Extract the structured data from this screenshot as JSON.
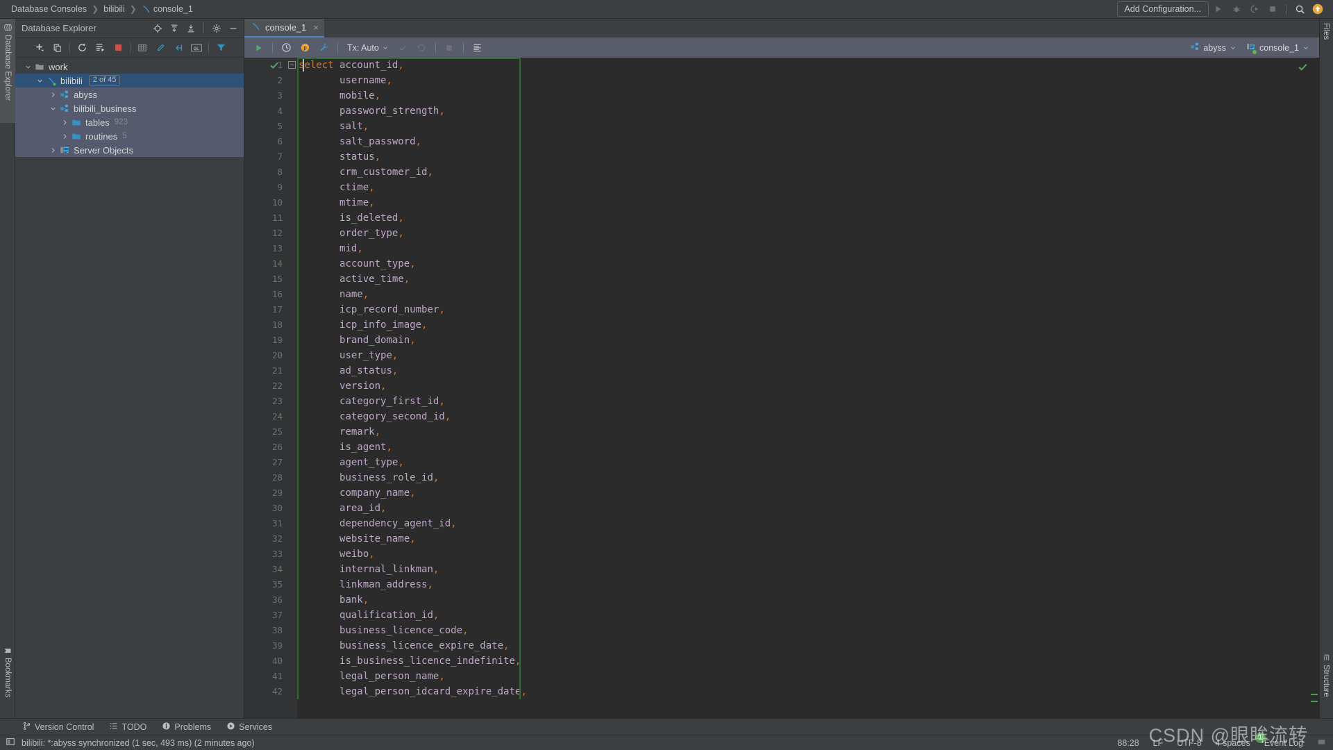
{
  "window": {
    "breadcrumb": [
      "Database Consoles",
      "bilibili",
      "console_1"
    ],
    "add_configuration_label": "Add Configuration...",
    "run_icon": "run-icon",
    "debug_icon": "debug-icon",
    "run_coverage_icon": "run-with-coverage-icon",
    "stop_icon": "stop-icon",
    "search_icon": "search-everywhere-icon",
    "updates_icon": "updates-available-icon"
  },
  "left_strips": {
    "database_explorer": "Database Explorer",
    "bookmarks": "Bookmarks"
  },
  "right_strips": {
    "files": "Files",
    "structure": "Structure"
  },
  "db_explorer": {
    "title": "Database Explorer",
    "header_icons": [
      "locate-icon",
      "expand-all-icon",
      "collapse-all-icon",
      "settings-gear-icon",
      "hide-minimize-icon"
    ],
    "toolbar_icons": [
      "add-new-icon",
      "copy-icon",
      "refresh-icon",
      "sql-script-icon",
      "stop-refresh-icon",
      "table-editor-icon",
      "modify-icon",
      "jump-to-console-icon",
      "ql-icon",
      "filter-icon"
    ],
    "tree": [
      {
        "label": "work",
        "icon": "folder-icon",
        "indent": 0,
        "twisty": "down",
        "state": "none"
      },
      {
        "label": "bilibili",
        "icon": "datagrip-db-icon",
        "indent": 1,
        "twisty": "down",
        "state": "selected-blue",
        "badge": "2 of 45"
      },
      {
        "label": "abyss",
        "icon": "schema-icon",
        "indent": 2,
        "twisty": "right",
        "state": "selected-grey"
      },
      {
        "label": "bilibili_business",
        "icon": "schema-icon",
        "indent": 2,
        "twisty": "down",
        "state": "selected-grey"
      },
      {
        "label": "tables",
        "icon": "folder-icon",
        "indent": 3,
        "twisty": "right",
        "state": "selected-grey",
        "count": "923"
      },
      {
        "label": "routines",
        "icon": "folder-icon",
        "indent": 3,
        "twisty": "right",
        "state": "selected-grey",
        "count": "5"
      },
      {
        "label": "Server Objects",
        "icon": "server-objects-icon",
        "indent": 2,
        "twisty": "right",
        "state": "selected-grey"
      }
    ]
  },
  "editor": {
    "tab": {
      "label": "console_1",
      "icon": "datagrip-console-icon",
      "close": "×"
    },
    "toolbar": {
      "execute_icon": "execute-run-icon",
      "history_icon": "history-clock-icon",
      "explain_icon": "explain-plan-icon",
      "settings_icon": "wrench-settings-icon",
      "tx_label": "Tx: Auto",
      "commit_icon": "commit-check-icon",
      "rollback_icon": "rollback-icon",
      "stop_icon": "stop-square-icon",
      "output_icon": "output-lines-icon",
      "schema_chip": {
        "label": "abyss",
        "icon": "schema-icon"
      },
      "session_chip": {
        "label": "console_1",
        "icon": "session-icon"
      }
    },
    "code_lines": [
      {
        "n": 1,
        "kw": "select",
        "ident": "account_id",
        "punc": ","
      },
      {
        "n": 2,
        "kw": "",
        "ident": "username",
        "punc": ","
      },
      {
        "n": 3,
        "kw": "",
        "ident": "mobile",
        "punc": ","
      },
      {
        "n": 4,
        "kw": "",
        "ident": "password_strength",
        "punc": ","
      },
      {
        "n": 5,
        "kw": "",
        "ident": "salt",
        "punc": ","
      },
      {
        "n": 6,
        "kw": "",
        "ident": "salt_password",
        "punc": ","
      },
      {
        "n": 7,
        "kw": "",
        "ident": "status",
        "punc": ","
      },
      {
        "n": 8,
        "kw": "",
        "ident": "crm_customer_id",
        "punc": ","
      },
      {
        "n": 9,
        "kw": "",
        "ident": "ctime",
        "punc": ","
      },
      {
        "n": 10,
        "kw": "",
        "ident": "mtime",
        "punc": ","
      },
      {
        "n": 11,
        "kw": "",
        "ident": "is_deleted",
        "punc": ","
      },
      {
        "n": 12,
        "kw": "",
        "ident": "order_type",
        "punc": ","
      },
      {
        "n": 13,
        "kw": "",
        "ident": "mid",
        "punc": ","
      },
      {
        "n": 14,
        "kw": "",
        "ident": "account_type",
        "punc": ","
      },
      {
        "n": 15,
        "kw": "",
        "ident": "active_time",
        "punc": ","
      },
      {
        "n": 16,
        "kw": "",
        "ident": "name",
        "punc": ","
      },
      {
        "n": 17,
        "kw": "",
        "ident": "icp_record_number",
        "punc": ","
      },
      {
        "n": 18,
        "kw": "",
        "ident": "icp_info_image",
        "punc": ","
      },
      {
        "n": 19,
        "kw": "",
        "ident": "brand_domain",
        "punc": ","
      },
      {
        "n": 20,
        "kw": "",
        "ident": "user_type",
        "punc": ","
      },
      {
        "n": 21,
        "kw": "",
        "ident": "ad_status",
        "punc": ","
      },
      {
        "n": 22,
        "kw": "",
        "ident": "version",
        "punc": ","
      },
      {
        "n": 23,
        "kw": "",
        "ident": "category_first_id",
        "punc": ","
      },
      {
        "n": 24,
        "kw": "",
        "ident": "category_second_id",
        "punc": ","
      },
      {
        "n": 25,
        "kw": "",
        "ident": "remark",
        "punc": ","
      },
      {
        "n": 26,
        "kw": "",
        "ident": "is_agent",
        "punc": ","
      },
      {
        "n": 27,
        "kw": "",
        "ident": "agent_type",
        "punc": ","
      },
      {
        "n": 28,
        "kw": "",
        "ident": "business_role_id",
        "punc": ","
      },
      {
        "n": 29,
        "kw": "",
        "ident": "company_name",
        "punc": ","
      },
      {
        "n": 30,
        "kw": "",
        "ident": "area_id",
        "punc": ","
      },
      {
        "n": 31,
        "kw": "",
        "ident": "dependency_agent_id",
        "punc": ","
      },
      {
        "n": 32,
        "kw": "",
        "ident": "website_name",
        "punc": ","
      },
      {
        "n": 33,
        "kw": "",
        "ident": "weibo",
        "punc": ","
      },
      {
        "n": 34,
        "kw": "",
        "ident": "internal_linkman",
        "punc": ","
      },
      {
        "n": 35,
        "kw": "",
        "ident": "linkman_address",
        "punc": ","
      },
      {
        "n": 36,
        "kw": "",
        "ident": "bank",
        "punc": ","
      },
      {
        "n": 37,
        "kw": "",
        "ident": "qualification_id",
        "punc": ","
      },
      {
        "n": 38,
        "kw": "",
        "ident": "business_licence_code",
        "punc": ","
      },
      {
        "n": 39,
        "kw": "",
        "ident": "business_licence_expire_date",
        "punc": ","
      },
      {
        "n": 40,
        "kw": "",
        "ident": "is_business_licence_indefinite",
        "punc": ","
      },
      {
        "n": 41,
        "kw": "",
        "ident": "legal_person_name",
        "punc": ","
      },
      {
        "n": 42,
        "kw": "",
        "ident": "legal_person_idcard_expire_date",
        "punc": ","
      }
    ]
  },
  "tool_window_bar": [
    {
      "label": "Version Control",
      "icon": "branch-icon"
    },
    {
      "label": "TODO",
      "icon": "todo-list-icon"
    },
    {
      "label": "Problems",
      "icon": "problems-warning-icon"
    },
    {
      "label": "Services",
      "icon": "services-play-icon"
    }
  ],
  "status_bar": {
    "message_icon": "message-console-icon",
    "message": "bilibili: *:abyss synchronized (1 sec, 493 ms) (2 minutes ago)",
    "caret_position": "88:28",
    "line_separator": "LF",
    "encoding": "UTF-8",
    "indent": "4 spaces",
    "event_log": "Event Log",
    "event_log_badge": "1",
    "watermark": "CSDN @眼眸流转"
  },
  "colors": {
    "accent_blue": "#4a88c7",
    "selection_blue": "#2d5177",
    "selection_grey": "#565a6e",
    "keyword_orange": "#cc7832",
    "identifier_purple": "#bfa7c9",
    "green_success": "#4f9e4f"
  }
}
